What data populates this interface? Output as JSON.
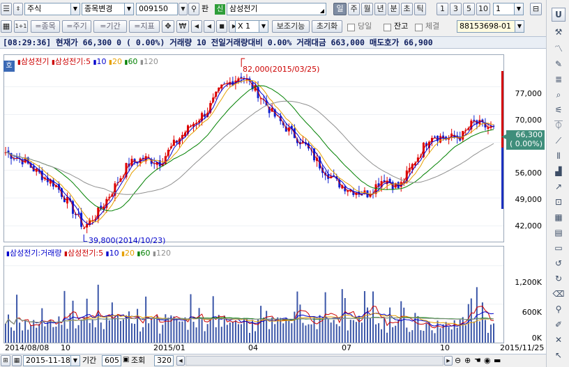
{
  "toolbar1": {
    "market_type": "주식",
    "stock_change_label": "종목변경",
    "stock_code": "009150",
    "pan_label": "판",
    "sin_badge": "신",
    "stock_name": "삼성전기",
    "period_tabs": [
      "일",
      "주",
      "월",
      "년",
      "분",
      "초",
      "틱"
    ],
    "minute_buttons": [
      "1",
      "3",
      "5",
      "10"
    ],
    "minute_select": "1",
    "lock_icon": "lock-icon",
    "u_button": "U"
  },
  "toolbar2": {
    "grid_icon": "grid-icon",
    "one_plus_one": "1+1",
    "buttons": [
      "=종목",
      "=주기",
      "=기간",
      "=지표"
    ],
    "move_icon": "move-cross-icon",
    "won_icon": "won-icon",
    "multiplier_label": "X 1",
    "aux_function": "보조기능",
    "reset": "초기화",
    "check_same_day": "당일",
    "check_balance": "잔고",
    "check_executed": "체결",
    "account": "88153698-01"
  },
  "quote": {
    "time": "[08:29:36]",
    "text": "현재가    66,300      0  ( 0.00%)  거래량 10  전일거래량대비 0.00%  거래대금 663,000  매도호가 66,900"
  },
  "price_pane": {
    "badge": "호",
    "legend": [
      {
        "text": "삼성전기",
        "color": "#cc0000"
      },
      {
        "text": "삼성전기:5",
        "color": "#cc0000"
      },
      {
        "text": "10",
        "color": "#0000cc"
      },
      {
        "text": "20",
        "color": "#e6a000"
      },
      {
        "text": "60",
        "color": "#008000"
      },
      {
        "text": "120",
        "color": "#909090"
      }
    ],
    "annotation_high": "82,000(2015/03/25)",
    "annotation_low": "39,800(2014/10/23)",
    "y_ticks": [
      "77,000",
      "70,000",
      "63,000",
      "56,000",
      "49,000",
      "42,000"
    ],
    "current_price": "66,300",
    "current_change": "( 0.00%)"
  },
  "volume_pane": {
    "legend": [
      {
        "text": "삼성전기:거래량",
        "color": "#0000cc"
      },
      {
        "text": "삼성전기:5",
        "color": "#cc0000"
      },
      {
        "text": "10",
        "color": "#0000cc"
      },
      {
        "text": "20",
        "color": "#e6a000"
      },
      {
        "text": "60",
        "color": "#008000"
      },
      {
        "text": "120",
        "color": "#909090"
      }
    ],
    "y_ticks": [
      "1,200K",
      "600K",
      "0K"
    ]
  },
  "x_axis": {
    "labels": [
      "2014/08/08",
      "10",
      "2015/01",
      "04",
      "07",
      "10",
      "2015/11/25"
    ]
  },
  "bottom_bar": {
    "date": "2015-11-18",
    "period_label": "기간",
    "period_value": "605",
    "query_label": "조회",
    "query_value": "320"
  },
  "chart_data": [
    {
      "type": "candlestick",
      "title": "삼성전기",
      "ylim": [
        38000,
        85000
      ],
      "x_start": "2014/08/08",
      "x_end": "2015/11/25",
      "annotations": [
        {
          "text": "82,000(2015/03/25)",
          "date": "2015/03/25",
          "value": 82000
        },
        {
          "text": "39,800(2014/10/23)",
          "date": "2014/10/23",
          "value": 39800
        }
      ],
      "close_path": [
        [
          "2014/08/08",
          60500
        ],
        [
          "2014/08/25",
          58500
        ],
        [
          "2014/09/10",
          55000
        ],
        [
          "2014/09/25",
          52500
        ],
        [
          "2014/10/10",
          47000
        ],
        [
          "2014/10/23",
          41500
        ],
        [
          "2014/11/05",
          45000
        ],
        [
          "2014/11/20",
          51000
        ],
        [
          "2014/12/05",
          57500
        ],
        [
          "2014/12/20",
          59000
        ],
        [
          "2015/01/05",
          58000
        ],
        [
          "2015/01/20",
          63000
        ],
        [
          "2015/02/05",
          67500
        ],
        [
          "2015/02/20",
          71000
        ],
        [
          "2015/03/05",
          76500
        ],
        [
          "2015/03/25",
          80000
        ],
        [
          "2015/04/10",
          75500
        ],
        [
          "2015/04/25",
          70000
        ],
        [
          "2015/05/10",
          66000
        ],
        [
          "2015/05/25",
          62500
        ],
        [
          "2015/06/10",
          57000
        ],
        [
          "2015/06/25",
          53000
        ],
        [
          "2015/07/10",
          51000
        ],
        [
          "2015/07/25",
          50000
        ],
        [
          "2015/08/10",
          54000
        ],
        [
          "2015/08/25",
          51500
        ],
        [
          "2015/09/10",
          58500
        ],
        [
          "2015/09/25",
          65000
        ],
        [
          "2015/10/10",
          64000
        ],
        [
          "2015/10/25",
          64500
        ],
        [
          "2015/11/05",
          68000
        ],
        [
          "2015/11/25",
          66300
        ]
      ],
      "series": [
        {
          "name": "5",
          "color": "#cc0000"
        },
        {
          "name": "10",
          "color": "#0000cc"
        },
        {
          "name": "20",
          "color": "#e6a000"
        },
        {
          "name": "60",
          "color": "#008000"
        },
        {
          "name": "120",
          "color": "#909090"
        }
      ]
    },
    {
      "type": "bar",
      "title": "삼성전기:거래량",
      "ylim": [
        0,
        1500000
      ],
      "y_ticks": [
        0,
        600000,
        1200000
      ]
    }
  ]
}
